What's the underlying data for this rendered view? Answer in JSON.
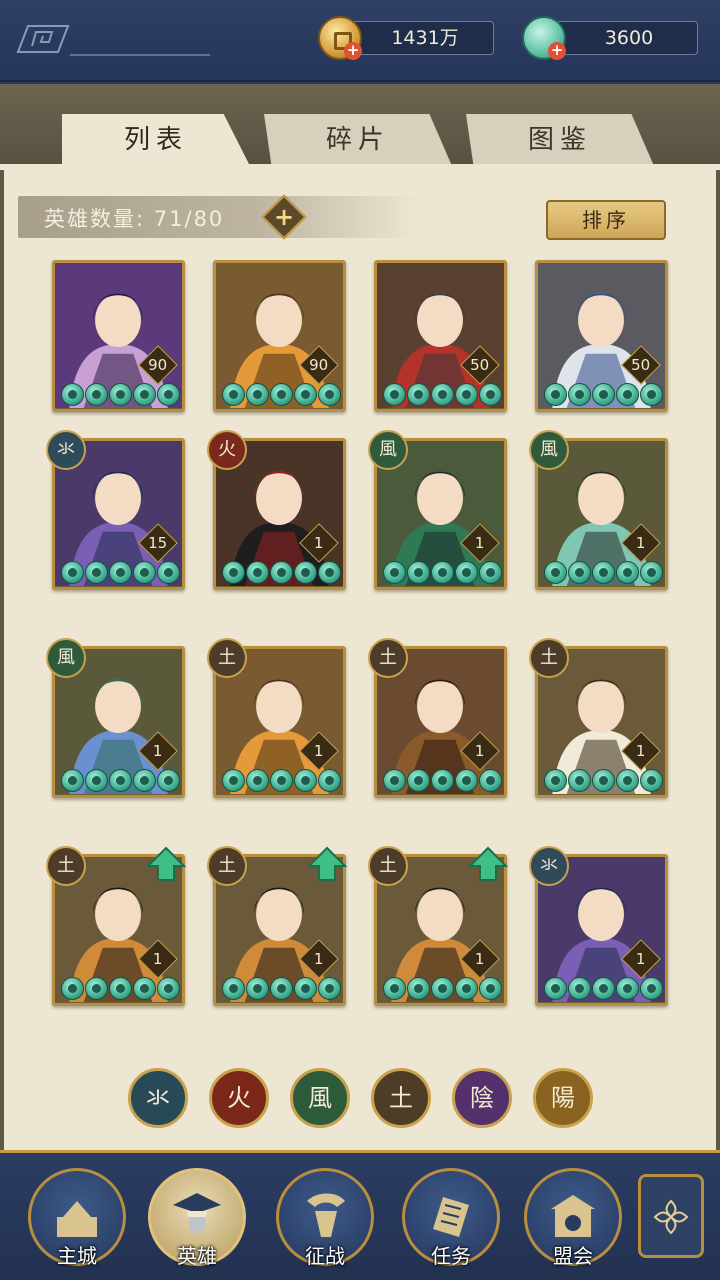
{
  "currencies": [
    {
      "name": "copper-coin",
      "value": "1431万",
      "icon": "coin-icon"
    },
    {
      "name": "jade",
      "value": "3600",
      "icon": "jade-icon"
    }
  ],
  "tabs": [
    {
      "label": "列表",
      "active": true
    },
    {
      "label": "碎片",
      "active": false
    },
    {
      "label": "图鉴",
      "active": false
    }
  ],
  "hero_count": {
    "label": "英雄数量:",
    "value": "71/80"
  },
  "sort_label": "排序",
  "heroes": [
    {
      "element": "",
      "level": "90",
      "upgrade": false,
      "palette": "purple"
    },
    {
      "element": "",
      "level": "90",
      "upgrade": false,
      "palette": "orange"
    },
    {
      "element": "",
      "level": "50",
      "upgrade": false,
      "palette": "red"
    },
    {
      "element": "",
      "level": "50",
      "upgrade": false,
      "palette": "silver"
    },
    {
      "element": "水",
      "element_glyph": "氺",
      "level": "15",
      "upgrade": false,
      "palette": "violet"
    },
    {
      "element": "火",
      "element_glyph": "火",
      "level": "1",
      "upgrade": false,
      "palette": "crimson"
    },
    {
      "element": "风",
      "element_glyph": "風",
      "level": "1",
      "upgrade": false,
      "palette": "green"
    },
    {
      "element": "风",
      "element_glyph": "風",
      "level": "1",
      "upgrade": false,
      "palette": "teal"
    },
    {
      "element": "风",
      "element_glyph": "風",
      "level": "1",
      "upgrade": false,
      "palette": "blue"
    },
    {
      "element": "土",
      "element_glyph": "土",
      "level": "1",
      "upgrade": false,
      "palette": "orange"
    },
    {
      "element": "土",
      "element_glyph": "土",
      "level": "1",
      "upgrade": false,
      "palette": "brown"
    },
    {
      "element": "土",
      "element_glyph": "土",
      "level": "1",
      "upgrade": false,
      "palette": "cream"
    },
    {
      "element": "土",
      "element_glyph": "土",
      "level": "1",
      "upgrade": true,
      "palette": "feather"
    },
    {
      "element": "土",
      "element_glyph": "土",
      "level": "1",
      "upgrade": true,
      "palette": "feather"
    },
    {
      "element": "土",
      "element_glyph": "土",
      "level": "1",
      "upgrade": true,
      "palette": "feather"
    },
    {
      "element": "水",
      "element_glyph": "氺",
      "level": "1",
      "upgrade": false,
      "palette": "violet"
    }
  ],
  "element_filters": [
    {
      "glyph": "氺",
      "class": "f-water"
    },
    {
      "glyph": "火",
      "class": "f-fire"
    },
    {
      "glyph": "風",
      "class": "f-wind"
    },
    {
      "glyph": "土",
      "class": "f-earth"
    },
    {
      "glyph": "陰",
      "class": "f-yin"
    },
    {
      "glyph": "陽",
      "class": "f-yang"
    }
  ],
  "nav": [
    {
      "label": "主城",
      "icon": "castle-icon",
      "active": false
    },
    {
      "label": "英雄",
      "icon": "hero-icon",
      "active": true
    },
    {
      "label": "征战",
      "icon": "battle-icon",
      "active": false
    },
    {
      "label": "任务",
      "icon": "quest-icon",
      "active": false
    },
    {
      "label": "盟会",
      "icon": "alliance-icon",
      "active": false
    }
  ],
  "colors": {
    "panel": "#ece6d3",
    "nav_bg": "#26355a",
    "gold": "#b78f3e",
    "jade": "#3fae91"
  }
}
